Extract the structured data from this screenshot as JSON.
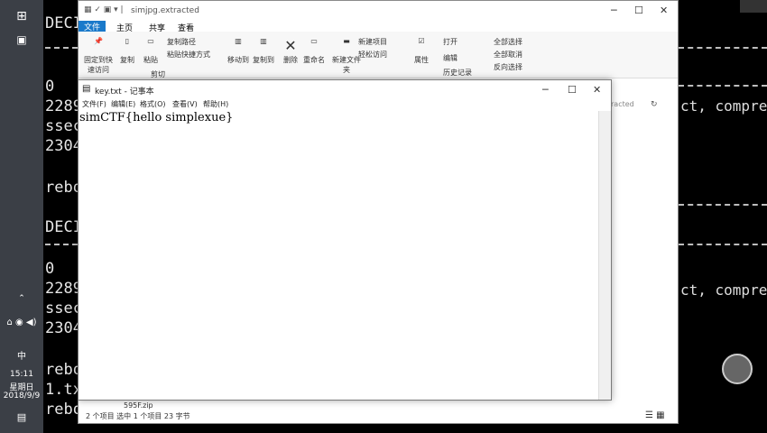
{
  "terminal": {
    "lines_left_1": [
      "DECI",
      "0",
      "2289",
      "ssec",
      "2304",
      "rebo"
    ],
    "lines_left_2": [
      "DECI",
      "0",
      "2289",
      "ssec",
      "2304",
      "rebo",
      "1.tx",
      "rebo"
    ],
    "right_1": "ct, compre",
    "right_2": "ct, compre"
  },
  "taskbar": {
    "time": "15:11",
    "weekday": "星期日",
    "date": "2018/9/9",
    "ime": "中"
  },
  "explorer": {
    "path": "simjpg.extracted",
    "tabs": [
      "文件",
      "主页",
      "共享",
      "查看"
    ],
    "ribbon": {
      "pin": "固定到快速访问",
      "copy": "复制",
      "paste": "粘贴",
      "copy_path": "复制路径",
      "paste_shortcut": "粘贴快捷方式",
      "cut": "剪切",
      "move_to": "移动到",
      "copy_to": "复制到",
      "delete": "删除",
      "rename": "重命名",
      "new_folder": "新建文件夹",
      "new_item": "新建项目",
      "easy_access": "轻松访问",
      "properties": "属性",
      "open": "打开",
      "edit": "编辑",
      "history": "历史记录",
      "select_all": "全部选择",
      "select_none": "全部取消",
      "invert": "反向选择"
    },
    "address_right": "racted",
    "file_item": "595F.zip",
    "status": "2 个项目  选中 1 个项目  23 字节"
  },
  "notepad": {
    "title": "key.txt - 记事本",
    "menu": [
      "文件(F)",
      "编辑(E)",
      "格式(O)",
      "查看(V)",
      "帮助(H)"
    ],
    "content": "simCTF{hello simplexue}"
  }
}
